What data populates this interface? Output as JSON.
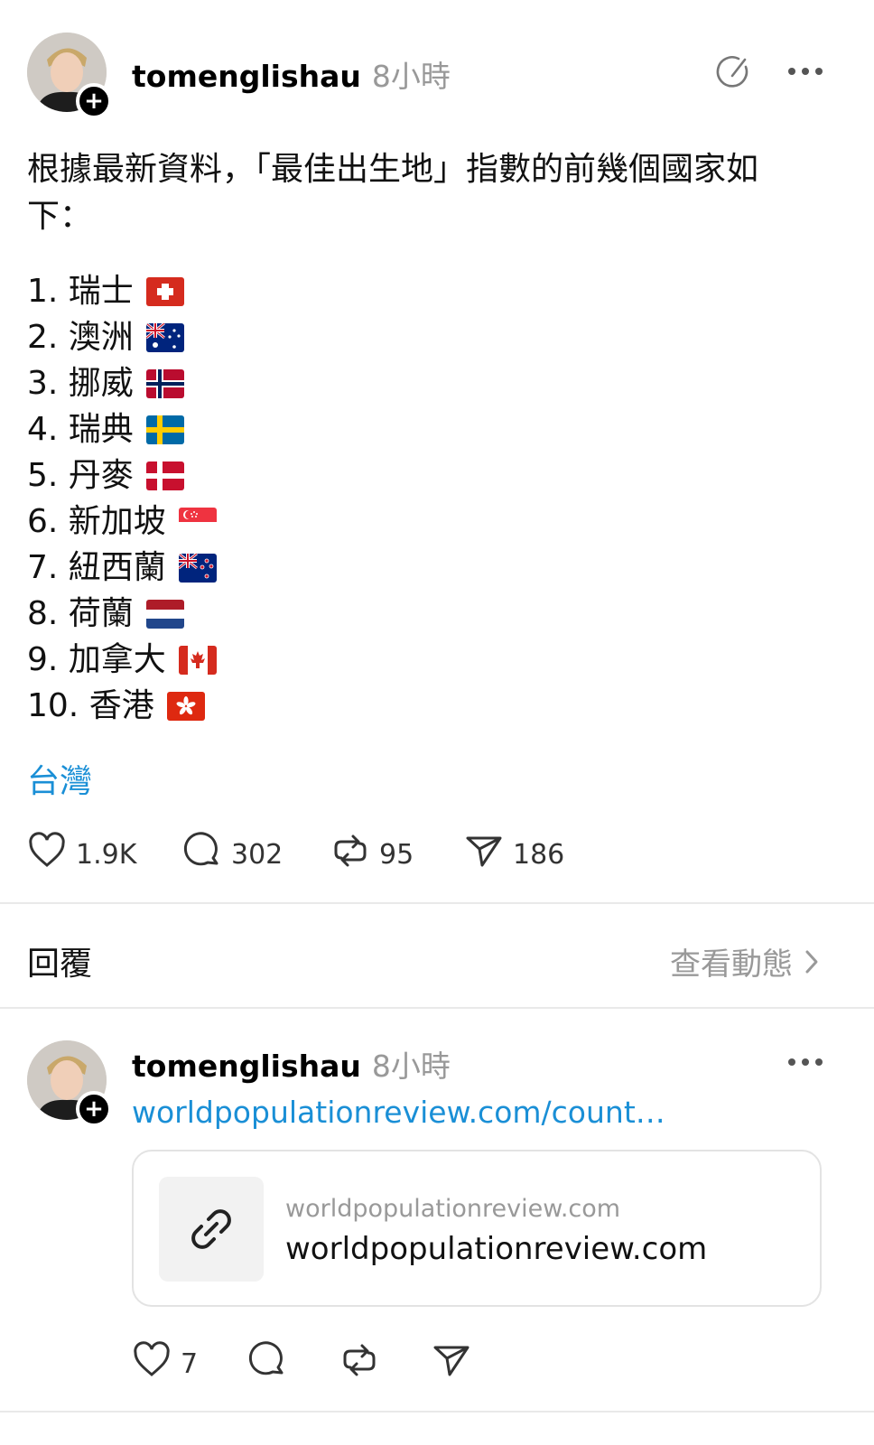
{
  "post": {
    "username": "tomenglishau",
    "time": "8小時",
    "text": "根據最新資料，「最佳出生地」指數的前幾個國家如下：",
    "list": [
      {
        "label": "1. 瑞士",
        "flag": "switzerland"
      },
      {
        "label": "2. 澳洲",
        "flag": "australia"
      },
      {
        "label": "3. 挪威",
        "flag": "norway"
      },
      {
        "label": "4. 瑞典",
        "flag": "sweden"
      },
      {
        "label": "5. 丹麥",
        "flag": "denmark"
      },
      {
        "label": "6. 新加坡",
        "flag": "singapore"
      },
      {
        "label": "7. 紐西蘭",
        "flag": "new-zealand"
      },
      {
        "label": "8. 荷蘭",
        "flag": "netherlands"
      },
      {
        "label": "9. 加拿大",
        "flag": "canada"
      },
      {
        "label": "10. 香港",
        "flag": "hong-kong"
      }
    ],
    "topic_tag": "台灣",
    "actions": {
      "likes": "1.9K",
      "replies": "302",
      "reposts": "95",
      "shares": "186"
    }
  },
  "replies_header": {
    "title": "回覆",
    "activity_link": "查看動態"
  },
  "reply": {
    "username": "tomenglishau",
    "time": "8小時",
    "link_text": "worldpopulationreview.com/count…",
    "card": {
      "domain": "worldpopulationreview.com",
      "title": "worldpopulationreview.com"
    },
    "actions": {
      "likes": "7"
    }
  },
  "colors": {
    "link": "#1a8fd6",
    "muted": "#999999",
    "divider": "#e9e9e9"
  },
  "icons": [
    "plus-icon",
    "edit-icon",
    "more-dots-icon",
    "heart-icon",
    "comment-icon",
    "repost-icon",
    "send-icon",
    "chevron-right-icon",
    "link-icon"
  ]
}
